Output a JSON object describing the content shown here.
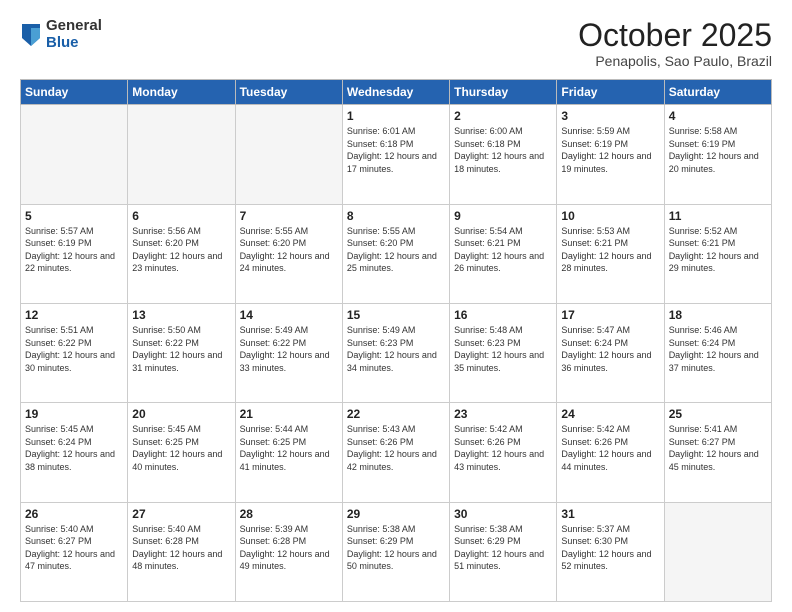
{
  "header": {
    "logo_general": "General",
    "logo_blue": "Blue",
    "month_title": "October 2025",
    "location": "Penapolis, Sao Paulo, Brazil"
  },
  "weekdays": [
    "Sunday",
    "Monday",
    "Tuesday",
    "Wednesday",
    "Thursday",
    "Friday",
    "Saturday"
  ],
  "weeks": [
    [
      {
        "day": "",
        "empty": true
      },
      {
        "day": "",
        "empty": true
      },
      {
        "day": "",
        "empty": true
      },
      {
        "day": "1",
        "sunrise": "Sunrise: 6:01 AM",
        "sunset": "Sunset: 6:18 PM",
        "daylight": "Daylight: 12 hours and 17 minutes."
      },
      {
        "day": "2",
        "sunrise": "Sunrise: 6:00 AM",
        "sunset": "Sunset: 6:18 PM",
        "daylight": "Daylight: 12 hours and 18 minutes."
      },
      {
        "day": "3",
        "sunrise": "Sunrise: 5:59 AM",
        "sunset": "Sunset: 6:19 PM",
        "daylight": "Daylight: 12 hours and 19 minutes."
      },
      {
        "day": "4",
        "sunrise": "Sunrise: 5:58 AM",
        "sunset": "Sunset: 6:19 PM",
        "daylight": "Daylight: 12 hours and 20 minutes."
      }
    ],
    [
      {
        "day": "5",
        "sunrise": "Sunrise: 5:57 AM",
        "sunset": "Sunset: 6:19 PM",
        "daylight": "Daylight: 12 hours and 22 minutes."
      },
      {
        "day": "6",
        "sunrise": "Sunrise: 5:56 AM",
        "sunset": "Sunset: 6:20 PM",
        "daylight": "Daylight: 12 hours and 23 minutes."
      },
      {
        "day": "7",
        "sunrise": "Sunrise: 5:55 AM",
        "sunset": "Sunset: 6:20 PM",
        "daylight": "Daylight: 12 hours and 24 minutes."
      },
      {
        "day": "8",
        "sunrise": "Sunrise: 5:55 AM",
        "sunset": "Sunset: 6:20 PM",
        "daylight": "Daylight: 12 hours and 25 minutes."
      },
      {
        "day": "9",
        "sunrise": "Sunrise: 5:54 AM",
        "sunset": "Sunset: 6:21 PM",
        "daylight": "Daylight: 12 hours and 26 minutes."
      },
      {
        "day": "10",
        "sunrise": "Sunrise: 5:53 AM",
        "sunset": "Sunset: 6:21 PM",
        "daylight": "Daylight: 12 hours and 28 minutes."
      },
      {
        "day": "11",
        "sunrise": "Sunrise: 5:52 AM",
        "sunset": "Sunset: 6:21 PM",
        "daylight": "Daylight: 12 hours and 29 minutes."
      }
    ],
    [
      {
        "day": "12",
        "sunrise": "Sunrise: 5:51 AM",
        "sunset": "Sunset: 6:22 PM",
        "daylight": "Daylight: 12 hours and 30 minutes."
      },
      {
        "day": "13",
        "sunrise": "Sunrise: 5:50 AM",
        "sunset": "Sunset: 6:22 PM",
        "daylight": "Daylight: 12 hours and 31 minutes."
      },
      {
        "day": "14",
        "sunrise": "Sunrise: 5:49 AM",
        "sunset": "Sunset: 6:22 PM",
        "daylight": "Daylight: 12 hours and 33 minutes."
      },
      {
        "day": "15",
        "sunrise": "Sunrise: 5:49 AM",
        "sunset": "Sunset: 6:23 PM",
        "daylight": "Daylight: 12 hours and 34 minutes."
      },
      {
        "day": "16",
        "sunrise": "Sunrise: 5:48 AM",
        "sunset": "Sunset: 6:23 PM",
        "daylight": "Daylight: 12 hours and 35 minutes."
      },
      {
        "day": "17",
        "sunrise": "Sunrise: 5:47 AM",
        "sunset": "Sunset: 6:24 PM",
        "daylight": "Daylight: 12 hours and 36 minutes."
      },
      {
        "day": "18",
        "sunrise": "Sunrise: 5:46 AM",
        "sunset": "Sunset: 6:24 PM",
        "daylight": "Daylight: 12 hours and 37 minutes."
      }
    ],
    [
      {
        "day": "19",
        "sunrise": "Sunrise: 5:45 AM",
        "sunset": "Sunset: 6:24 PM",
        "daylight": "Daylight: 12 hours and 38 minutes."
      },
      {
        "day": "20",
        "sunrise": "Sunrise: 5:45 AM",
        "sunset": "Sunset: 6:25 PM",
        "daylight": "Daylight: 12 hours and 40 minutes."
      },
      {
        "day": "21",
        "sunrise": "Sunrise: 5:44 AM",
        "sunset": "Sunset: 6:25 PM",
        "daylight": "Daylight: 12 hours and 41 minutes."
      },
      {
        "day": "22",
        "sunrise": "Sunrise: 5:43 AM",
        "sunset": "Sunset: 6:26 PM",
        "daylight": "Daylight: 12 hours and 42 minutes."
      },
      {
        "day": "23",
        "sunrise": "Sunrise: 5:42 AM",
        "sunset": "Sunset: 6:26 PM",
        "daylight": "Daylight: 12 hours and 43 minutes."
      },
      {
        "day": "24",
        "sunrise": "Sunrise: 5:42 AM",
        "sunset": "Sunset: 6:26 PM",
        "daylight": "Daylight: 12 hours and 44 minutes."
      },
      {
        "day": "25",
        "sunrise": "Sunrise: 5:41 AM",
        "sunset": "Sunset: 6:27 PM",
        "daylight": "Daylight: 12 hours and 45 minutes."
      }
    ],
    [
      {
        "day": "26",
        "sunrise": "Sunrise: 5:40 AM",
        "sunset": "Sunset: 6:27 PM",
        "daylight": "Daylight: 12 hours and 47 minutes."
      },
      {
        "day": "27",
        "sunrise": "Sunrise: 5:40 AM",
        "sunset": "Sunset: 6:28 PM",
        "daylight": "Daylight: 12 hours and 48 minutes."
      },
      {
        "day": "28",
        "sunrise": "Sunrise: 5:39 AM",
        "sunset": "Sunset: 6:28 PM",
        "daylight": "Daylight: 12 hours and 49 minutes."
      },
      {
        "day": "29",
        "sunrise": "Sunrise: 5:38 AM",
        "sunset": "Sunset: 6:29 PM",
        "daylight": "Daylight: 12 hours and 50 minutes."
      },
      {
        "day": "30",
        "sunrise": "Sunrise: 5:38 AM",
        "sunset": "Sunset: 6:29 PM",
        "daylight": "Daylight: 12 hours and 51 minutes."
      },
      {
        "day": "31",
        "sunrise": "Sunrise: 5:37 AM",
        "sunset": "Sunset: 6:30 PM",
        "daylight": "Daylight: 12 hours and 52 minutes."
      },
      {
        "day": "",
        "empty": true
      }
    ]
  ]
}
